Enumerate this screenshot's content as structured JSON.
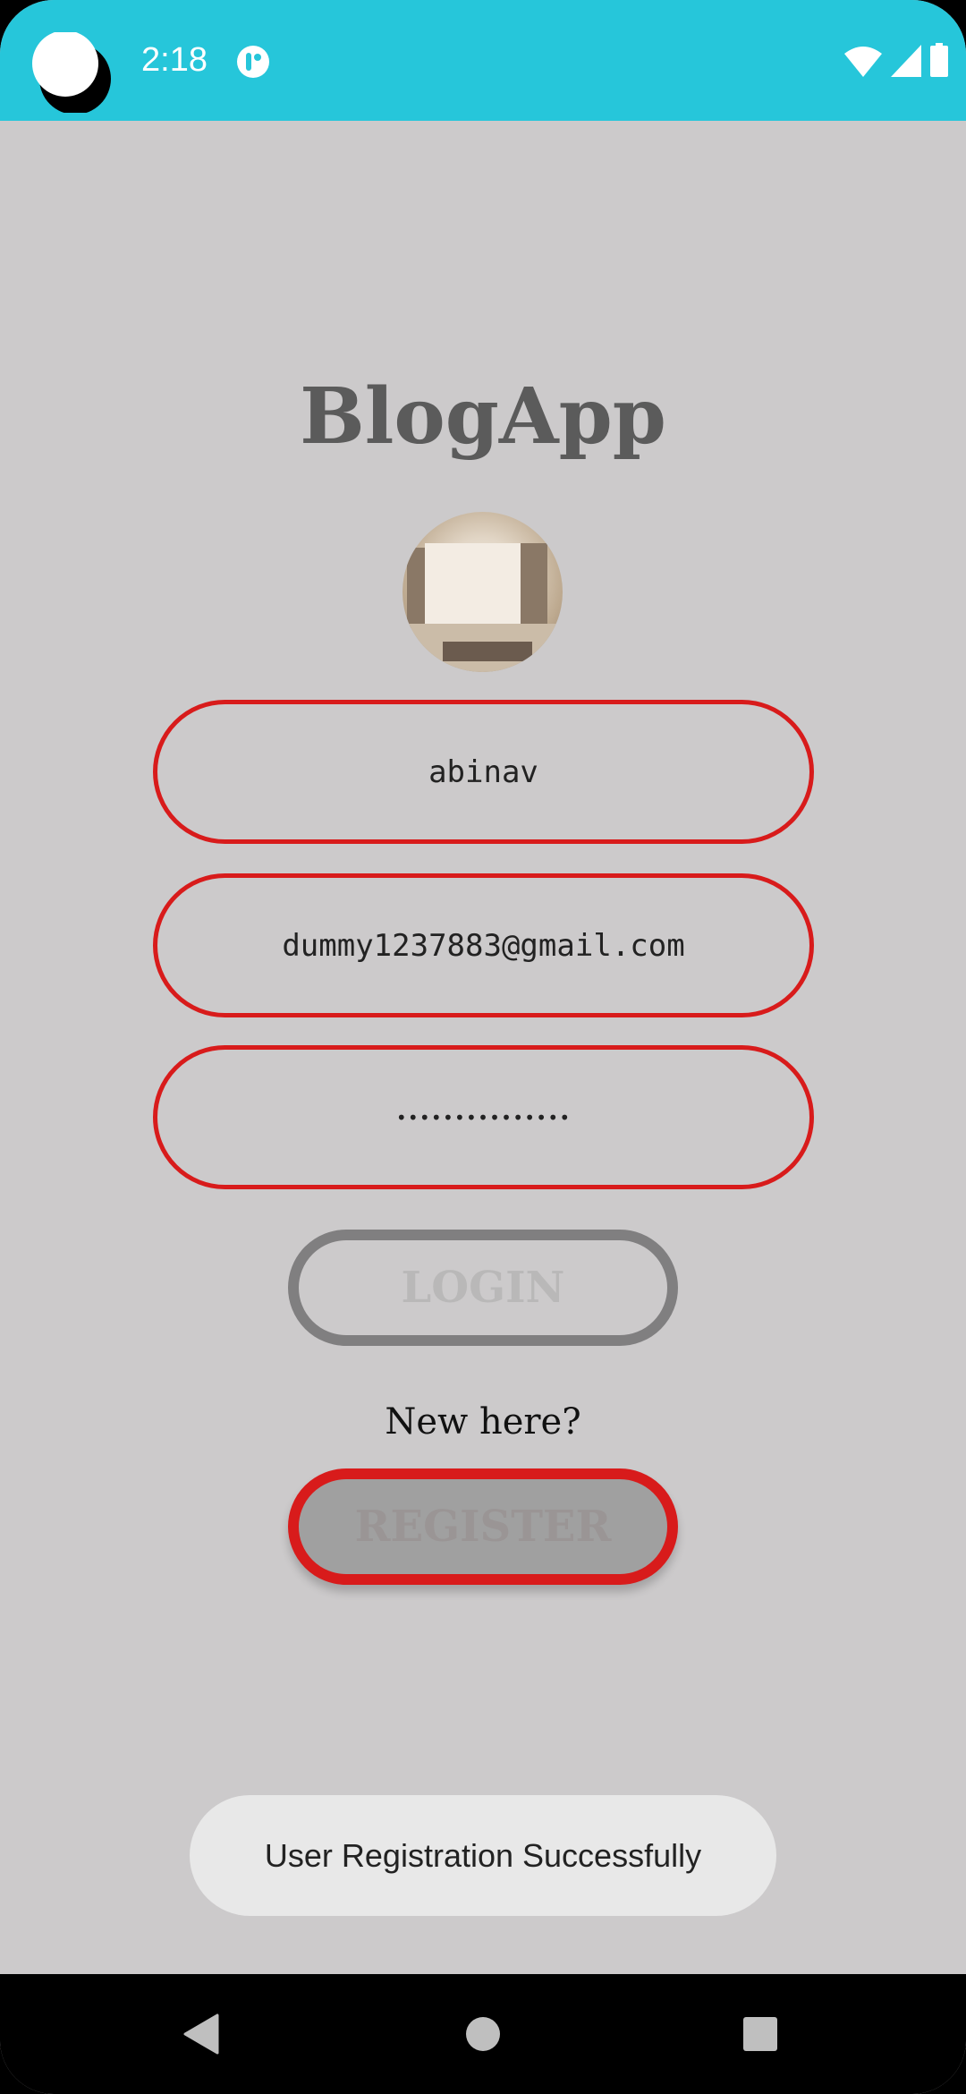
{
  "status_bar": {
    "time": "2:18",
    "bg_color": "#26c6da"
  },
  "app": {
    "title": "BlogApp"
  },
  "form": {
    "name_value": "abinav",
    "email_value": "dummy1237883@gmail.com",
    "password_value": "•••••••••••••••"
  },
  "buttons": {
    "login": "LOGIN",
    "register": "REGISTER"
  },
  "new_here": "New here?",
  "toast": "User Registration Successfully",
  "colors": {
    "accent": "#d81b1b",
    "background": "#cccacb"
  }
}
